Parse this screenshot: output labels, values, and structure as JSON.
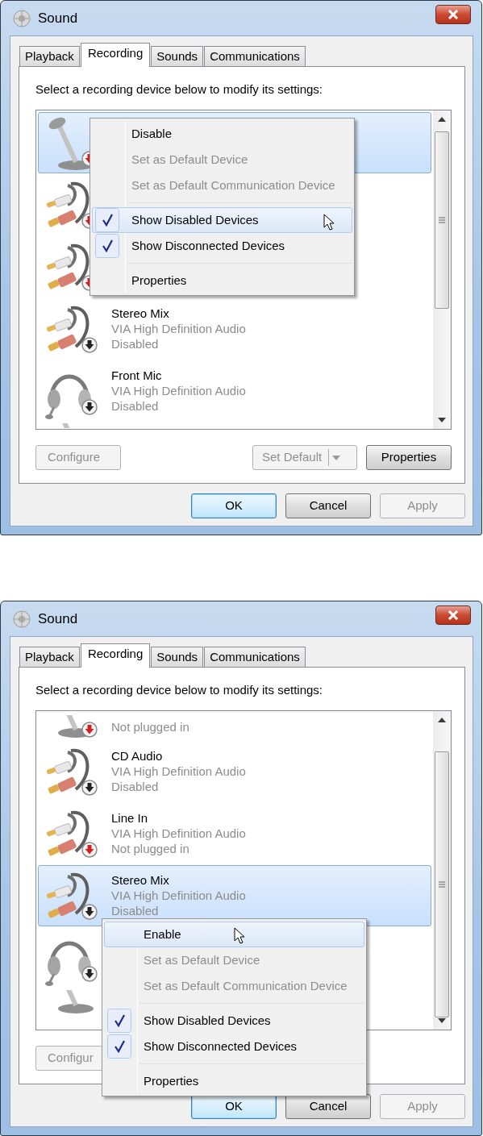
{
  "dialogs": [
    {
      "title": "Sound",
      "tabs": [
        {
          "label": "Playback",
          "selected": false
        },
        {
          "label": "Recording",
          "selected": true
        },
        {
          "label": "Sounds",
          "selected": false
        },
        {
          "label": "Communications",
          "selected": false
        }
      ],
      "instruction": "Select a recording device below to modify its settings:",
      "device_list": {
        "scrolled": false,
        "rows": [
          {
            "kind": "microphone",
            "unplugged": true,
            "selected": true
          },
          {
            "kind": "cable",
            "unplugged": true,
            "selected": false
          },
          {
            "kind": "cable",
            "unplugged": true,
            "selected": false
          },
          {
            "kind": "cable",
            "unplugged": false,
            "name": "Stereo Mix",
            "driver": "VIA High Definition Audio",
            "state": "Disabled",
            "selected": false
          },
          {
            "kind": "headset",
            "unplugged": false,
            "name": "Front Mic",
            "driver": "VIA High Definition Audio",
            "state": "Disabled",
            "selected": false
          },
          {
            "kind": "microphone",
            "cut": true,
            "selected": false
          }
        ]
      },
      "context_menu": {
        "items": [
          {
            "kind": "item",
            "label": "Disable",
            "disabled": false,
            "checked": false,
            "highlighted": false
          },
          {
            "kind": "item",
            "label": "Set as Default Device",
            "disabled": true,
            "checked": false,
            "highlighted": false
          },
          {
            "kind": "item",
            "label": "Set as Default Communication Device",
            "disabled": true,
            "checked": false,
            "highlighted": false
          },
          {
            "kind": "separator"
          },
          {
            "kind": "item",
            "label": "Show Disabled Devices",
            "disabled": false,
            "checked": true,
            "highlighted": true
          },
          {
            "kind": "item",
            "label": "Show Disconnected Devices",
            "disabled": false,
            "checked": true,
            "highlighted": false
          },
          {
            "kind": "separator"
          },
          {
            "kind": "item",
            "label": "Properties",
            "disabled": false,
            "checked": false,
            "highlighted": false
          }
        ]
      },
      "device_buttons": [
        {
          "kind": "button",
          "label": "Configure",
          "disabled": true
        },
        {
          "kind": "split",
          "label": "Set Default",
          "disabled": true
        },
        {
          "kind": "button",
          "label": "Properties",
          "disabled": false
        }
      ],
      "buttons": [
        {
          "label": "OK",
          "disabled": false,
          "default": true
        },
        {
          "label": "Cancel",
          "disabled": false,
          "default": false
        },
        {
          "label": "Apply",
          "disabled": true,
          "default": false
        }
      ]
    },
    {
      "title": "Sound",
      "tabs": [
        {
          "label": "Playback",
          "selected": false
        },
        {
          "label": "Recording",
          "selected": true
        },
        {
          "label": "Sounds",
          "selected": false
        },
        {
          "label": "Communications",
          "selected": false
        }
      ],
      "instruction": "Select a recording device below to modify its settings:",
      "device_list": {
        "scrolled": true,
        "rows": [
          {
            "kind": "microphone",
            "unplugged": true,
            "state": "Not plugged in",
            "cut": true,
            "selected": false
          },
          {
            "kind": "cable",
            "unplugged": false,
            "name": "CD Audio",
            "driver": "VIA High Definition Audio",
            "state": "Disabled",
            "selected": false
          },
          {
            "kind": "cable",
            "unplugged": true,
            "name": "Line In",
            "driver": "VIA High Definition Audio",
            "state": "Not plugged in",
            "selected": false
          },
          {
            "kind": "cable",
            "unplugged": false,
            "name": "Stereo Mix",
            "driver": "VIA High Definition Audio",
            "state": "Disabled",
            "selected": true
          },
          {
            "kind": "headset",
            "unplugged": false,
            "selected": false
          },
          {
            "kind": "microphone",
            "cut": true,
            "selected": false
          }
        ]
      },
      "context_menu": {
        "items": [
          {
            "kind": "item",
            "label": "Enable",
            "disabled": false,
            "checked": false,
            "highlighted": true
          },
          {
            "kind": "item",
            "label": "Set as Default Device",
            "disabled": true,
            "checked": false,
            "highlighted": false
          },
          {
            "kind": "item",
            "label": "Set as Default Communication Device",
            "disabled": true,
            "checked": false,
            "highlighted": false
          },
          {
            "kind": "separator"
          },
          {
            "kind": "item",
            "label": "Show Disabled Devices",
            "disabled": false,
            "checked": true,
            "highlighted": false
          },
          {
            "kind": "item",
            "label": "Show Disconnected Devices",
            "disabled": false,
            "checked": true,
            "highlighted": false
          },
          {
            "kind": "separator"
          },
          {
            "kind": "item",
            "label": "Properties",
            "disabled": false,
            "checked": false,
            "highlighted": false
          }
        ]
      },
      "device_buttons": [
        {
          "kind": "button",
          "label": "Configur",
          "disabled": true
        }
      ],
      "buttons": [
        {
          "label": "OK",
          "disabled": false,
          "default": true
        },
        {
          "label": "Cancel",
          "disabled": false,
          "default": false
        },
        {
          "label": "Apply",
          "disabled": true,
          "default": false
        }
      ]
    }
  ]
}
